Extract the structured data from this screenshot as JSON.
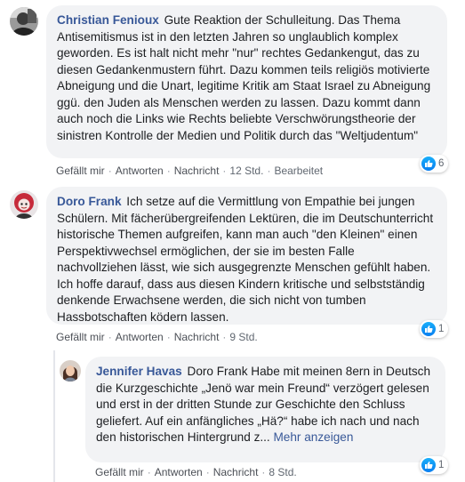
{
  "comments": [
    {
      "author": "Christian Fenioux",
      "text": "Gute Reaktion der Schulleitung. Das Thema Antisemitismus ist in den letzten Jahren so unglaublich komplex geworden. Es ist halt nicht mehr \"nur\" rechtes Gedankengut, das zu diesen Gedankenmustern führt. Dazu kommen teils religiös motivierte Abneigung und die Unart, legitime Kritik am Staat Israel zu Abneigung ggü. den Juden als Menschen werden zu lassen. Dazu kommt dann auch noch die Links wie Rechts beliebte Verschwörungstheorie der sinistren Kontrolle der Medien und Politik durch das \"Weltjudentum\"",
      "actions": {
        "like": "Gefällt mir",
        "reply": "Antworten",
        "message": "Nachricht",
        "time": "12 Std.",
        "edited": "Bearbeitet"
      },
      "reaction_count": "6",
      "reaction_icon": "thumbs-up-icon",
      "avatar_icon": "grayscale-portrait-icon"
    },
    {
      "author": "Doro Frank",
      "text": "Ich setze auf die Vermittlung von Empathie bei jungen Schülern. Mit fächerübergreifenden Lektüren, die im Deutschunterricht historische Themen aufgreifen, kann man auch \"den Kleinen\" einen Perspektivwechsel ermöglichen, der sie im besten Falle nachvollziehen lässt, wie sich ausgegrenzte Menschen gefühlt haben. Ich hoffe darauf, dass aus diesen Kindern kritische und selbstständig denkende Erwachsene werden, die sich nicht von tumben Hassbotschaften ködern lassen.",
      "actions": {
        "like": "Gefällt mir",
        "reply": "Antworten",
        "message": "Nachricht",
        "time": "9 Std."
      },
      "reaction_count": "1",
      "reaction_icon": "thumbs-up-icon",
      "avatar_icon": "red-hair-avatar-icon"
    }
  ],
  "reply": {
    "author": "Jennifer Havas",
    "text": "Doro Frank Habe mit meinen 8ern in Deutsch die Kurzgeschichte „Jenö war mein Freund“ verzögert gelesen und erst in der dritten Stunde zur Geschichte den Schluss geliefert. Auf ein anfängliches „Hä?“ habe ich nach und nach den historischen Hintergrund z...",
    "more": "Mehr anzeigen",
    "actions": {
      "like": "Gefällt mir",
      "reply": "Antworten",
      "message": "Nachricht",
      "time": "8 Std."
    },
    "reaction_count": "1",
    "reaction_icon": "thumbs-up-icon",
    "avatar_icon": "woman-portrait-icon"
  },
  "colors": {
    "author": "#385898",
    "bubble": "#f2f3f5",
    "like": "#1877f2"
  }
}
